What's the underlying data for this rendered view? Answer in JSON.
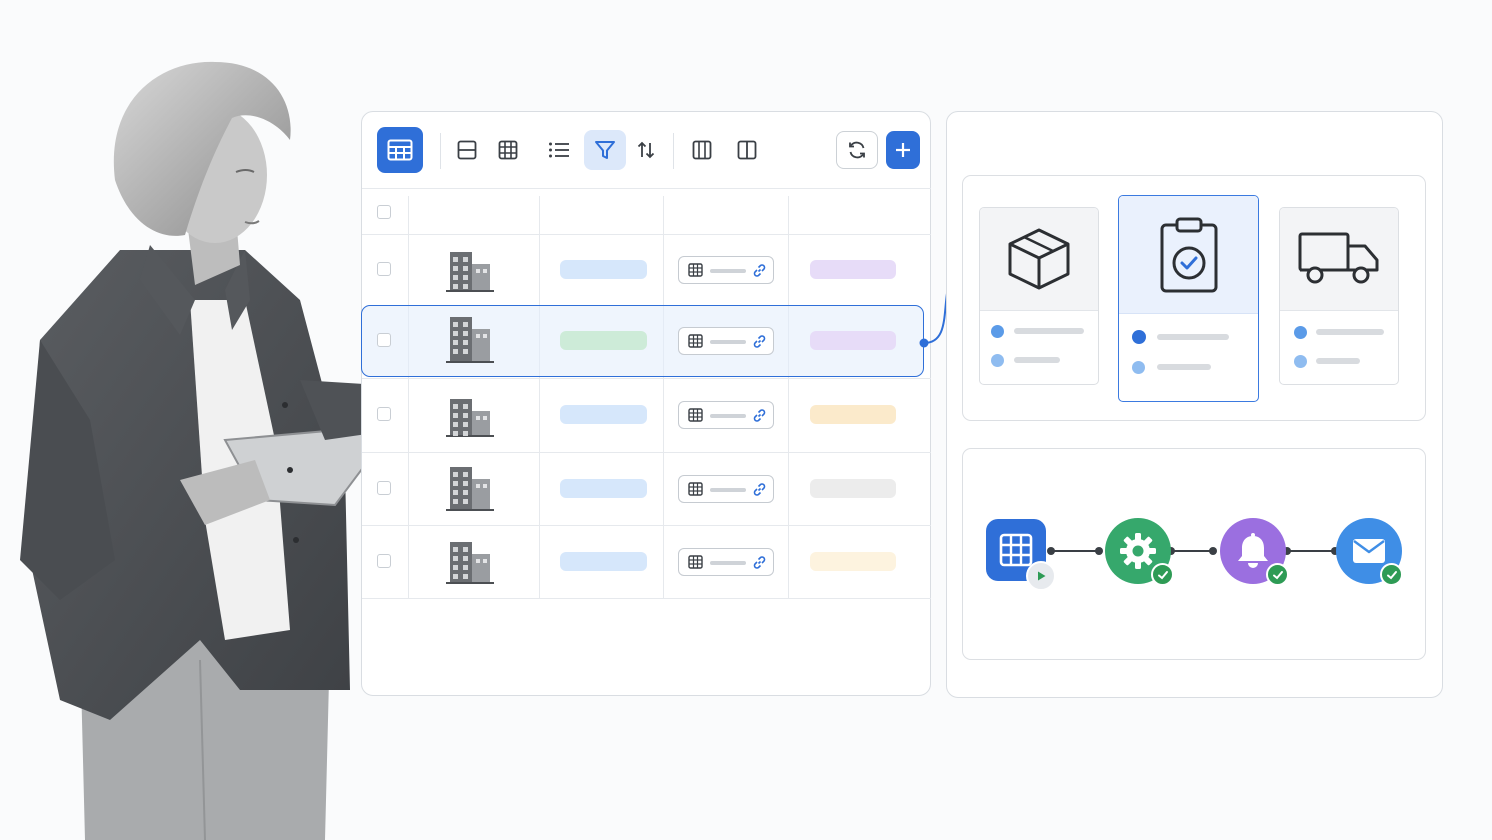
{
  "colors": {
    "accent": "#2f6fd8",
    "pill_blue": "#d6e7fb",
    "pill_green": "#cdebd8",
    "pill_purple": "#e7dcf8",
    "pill_yellow": "#fbeacb",
    "pill_gray": "#ececec",
    "pill_pale_yellow": "#fdf3df",
    "node_table": "#2f6fd8",
    "node_settings": "#36a86c",
    "node_notify": "#9b6fe0",
    "node_email": "#3f8ee6",
    "check_green": "#2e9b55"
  },
  "toolbar": {
    "icons": [
      "table-view-icon",
      "row-view-icon",
      "grid-view-icon",
      "list-view-icon",
      "filter-icon",
      "sort-icon",
      "columns-icon",
      "split-view-icon",
      "refresh-icon",
      "add-icon"
    ],
    "active": "table-view",
    "filter_active": true
  },
  "table": {
    "rows": [
      {
        "image": "building-icon",
        "status_color": "pill_blue",
        "tag_color": "pill_purple",
        "selected": false
      },
      {
        "image": "building-icon",
        "status_color": "pill_green",
        "tag_color": "pill_purple",
        "selected": true
      },
      {
        "image": "building-icon",
        "status_color": "pill_blue",
        "tag_color": "pill_yellow",
        "selected": false
      },
      {
        "image": "building-icon",
        "status_color": "pill_blue",
        "tag_color": "pill_gray",
        "selected": false
      },
      {
        "image": "building-icon",
        "status_color": "pill_blue",
        "tag_color": "pill_pale_yellow",
        "selected": false
      }
    ]
  },
  "stages": [
    {
      "icon": "box-icon",
      "active": false
    },
    {
      "icon": "clipboard-check-icon",
      "active": true
    },
    {
      "icon": "truck-icon",
      "active": false
    }
  ],
  "automation": {
    "nodes": [
      "table-icon",
      "gear-icon",
      "bell-icon",
      "mail-icon"
    ],
    "completed": [
      false,
      true,
      true,
      true
    ]
  }
}
